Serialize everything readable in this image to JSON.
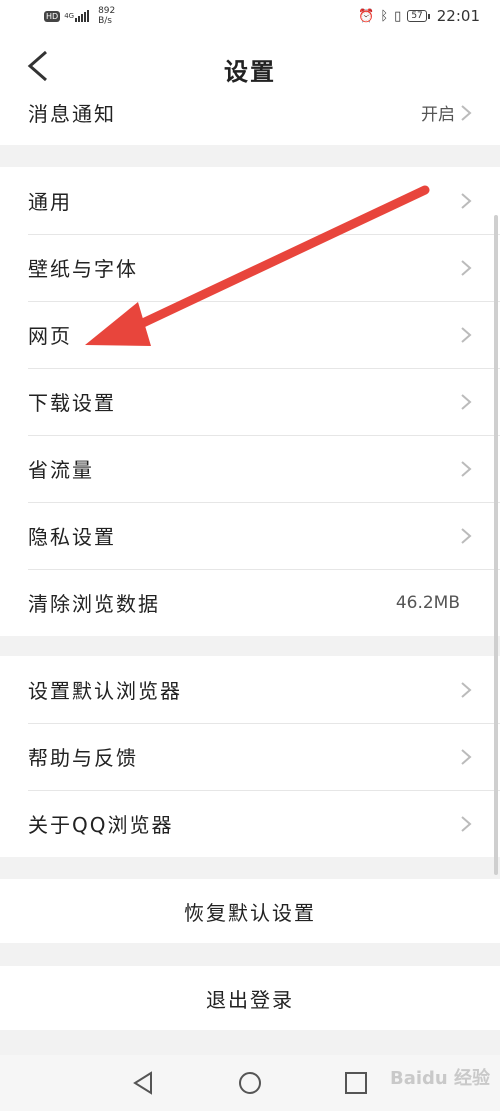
{
  "status_bar": {
    "hd": "HD",
    "network": "4G",
    "speed_value": "892",
    "speed_unit": "B/s",
    "battery": "57",
    "time": "22:01"
  },
  "header": {
    "title": "设置"
  },
  "notify": {
    "label": "消息通知",
    "value": "开启"
  },
  "group1": [
    {
      "label": "通用"
    },
    {
      "label": "壁纸与字体"
    },
    {
      "label": "网页"
    },
    {
      "label": "下载设置"
    },
    {
      "label": "省流量"
    },
    {
      "label": "隐私设置"
    },
    {
      "label": "清除浏览数据",
      "value": "46.2MB"
    }
  ],
  "group2": [
    {
      "label": "设置默认浏览器"
    },
    {
      "label": "帮助与反馈"
    },
    {
      "label": "关于QQ浏览器"
    }
  ],
  "actions": {
    "restore_default": "恢复默认设置",
    "logout": "退出登录"
  },
  "watermark": "Baidu 经验",
  "colors": {
    "arrow": "#e8453c",
    "background": "#f2f2f2"
  }
}
